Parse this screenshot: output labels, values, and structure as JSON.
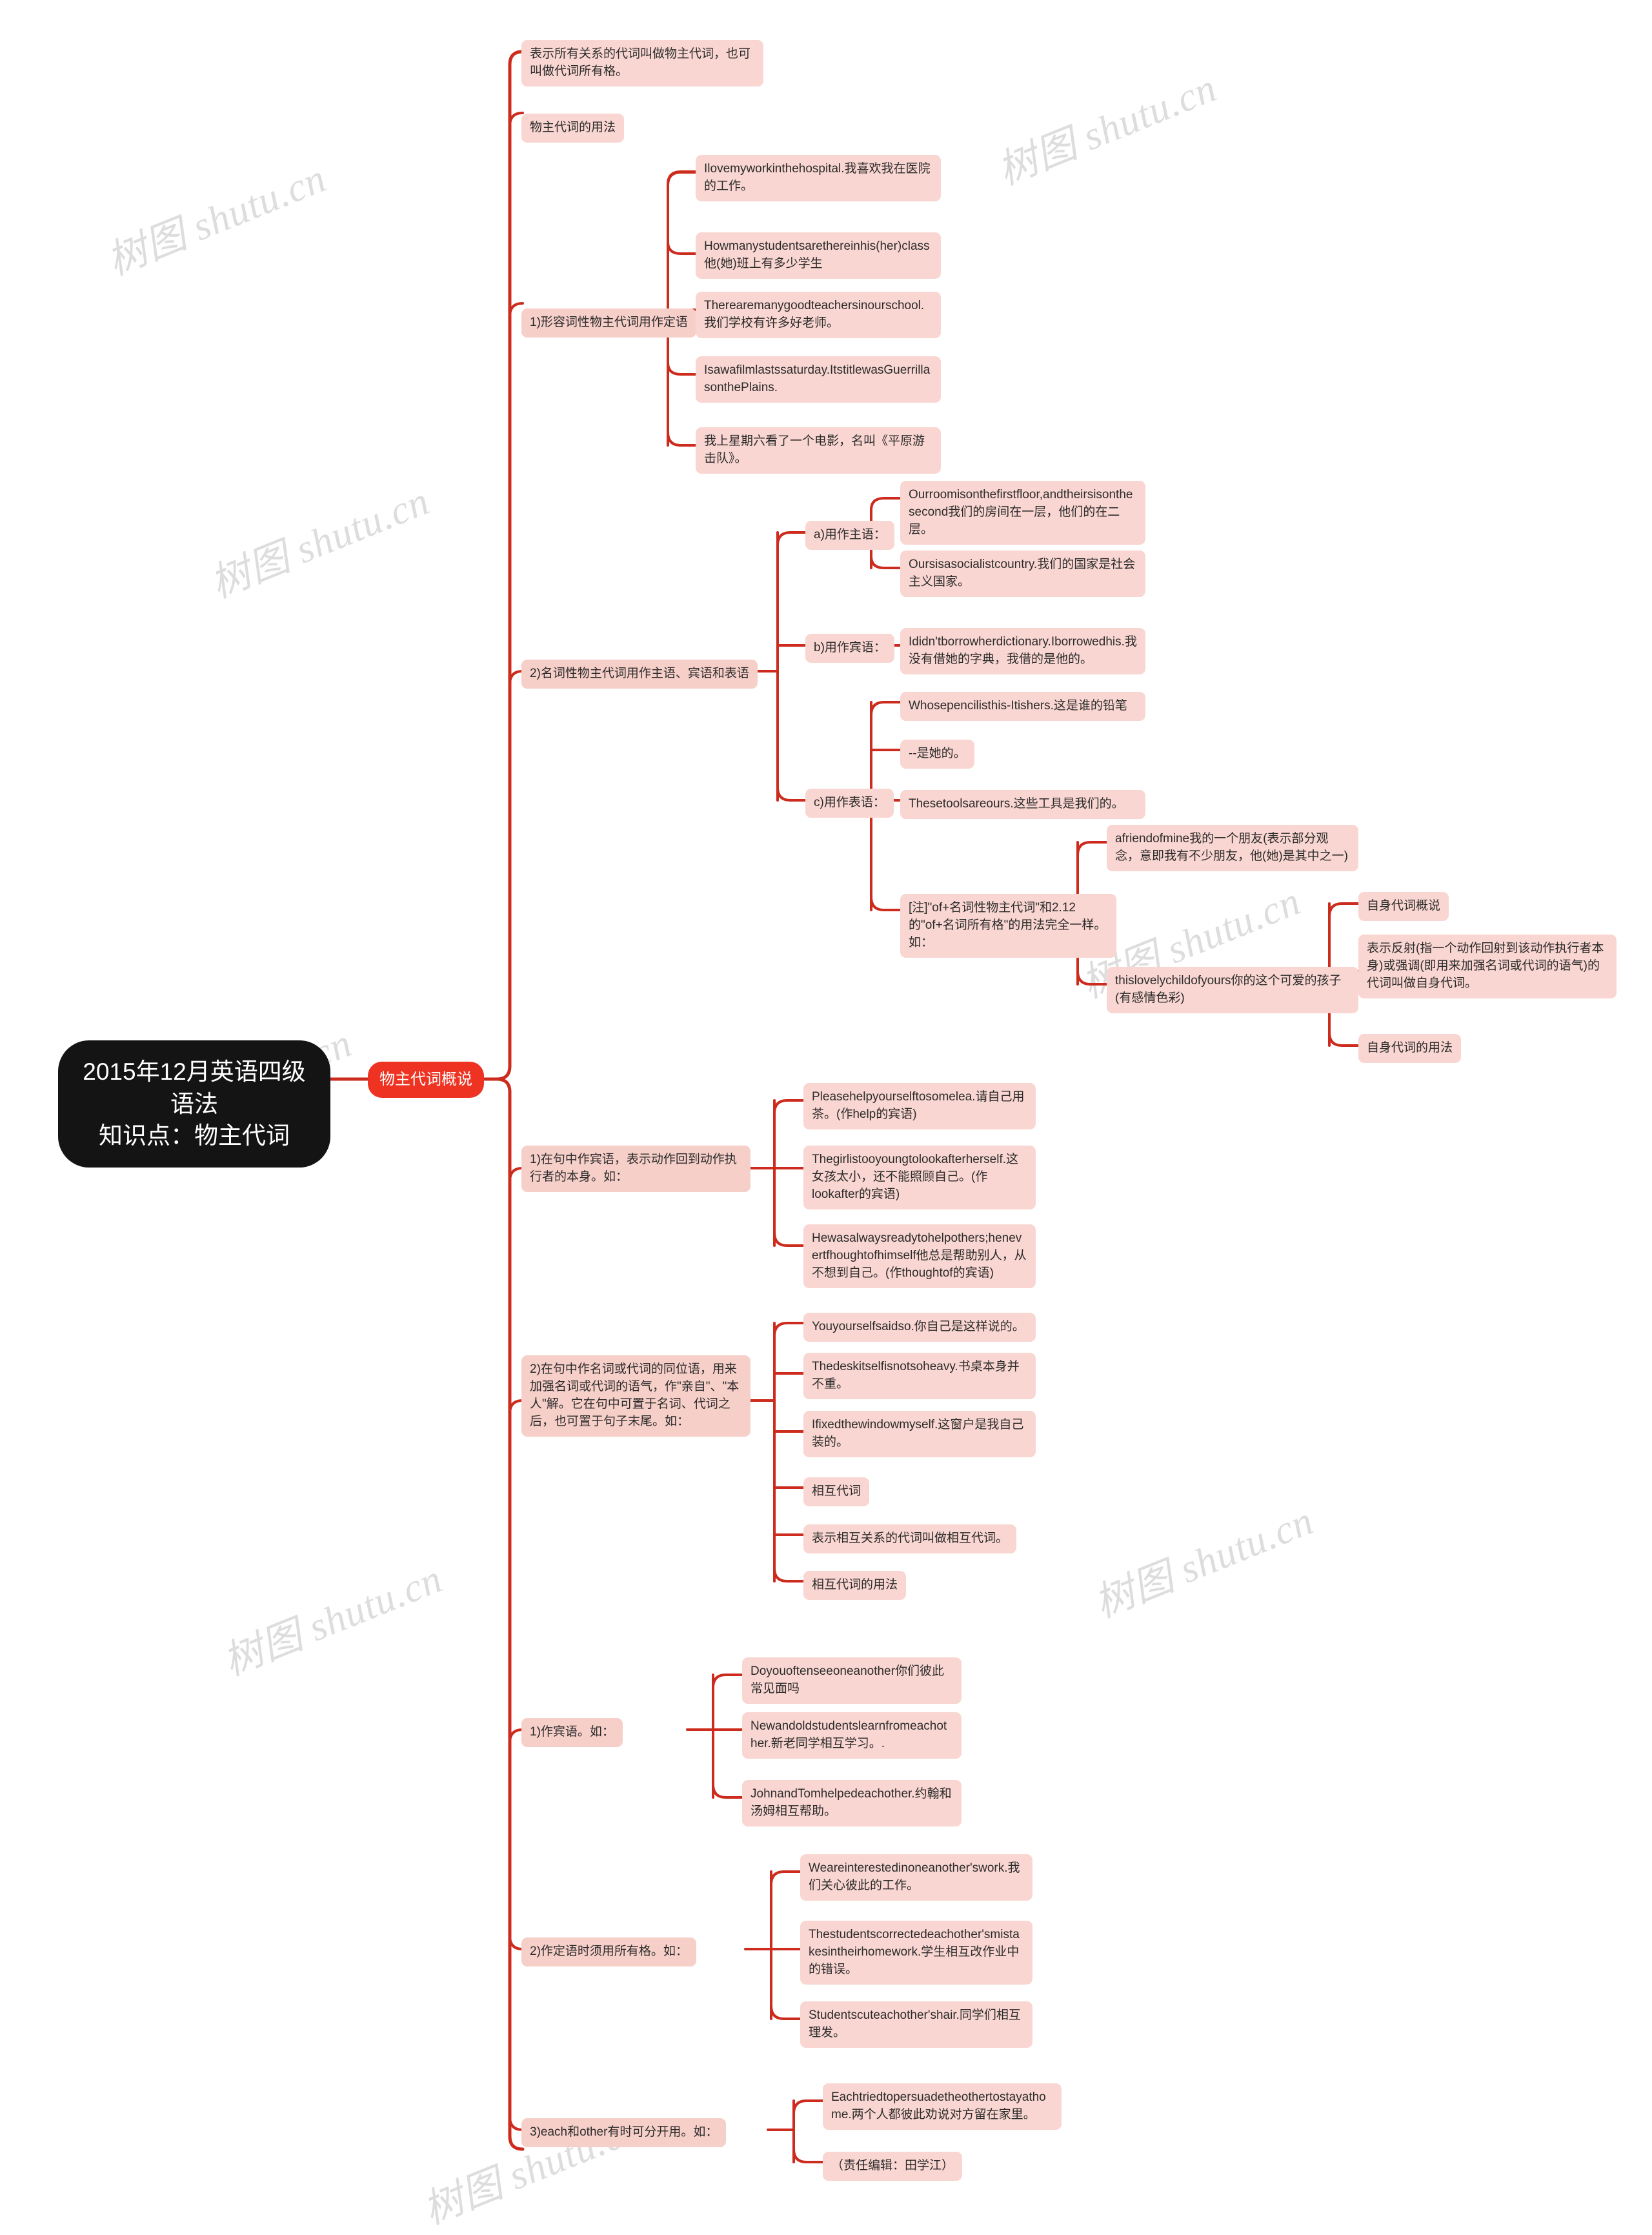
{
  "meta": {
    "accent_red": "#ee3322",
    "node_fill": "#f9d6d1",
    "root_fill": "#141414",
    "background": "#ffffff",
    "watermark_text": "树图 shutu.cn"
  },
  "root": {
    "label": "2015年12月英语四级语法\n知识点：物主代词"
  },
  "topic": {
    "label": "物主代词概说"
  },
  "nodes": {
    "n_intro": "表示所有关系的代词叫做物主代词，也可叫做代词所有格。",
    "n_usage": "物主代词的用法",
    "b1_label": "1)形容词性物主代词用作定语",
    "b1_e1": "Ilovemyworkinthehospital.我喜欢我在医院的工作。",
    "b1_e2": "Howmanystudentsarethereinhis(her)class他(她)班上有多少学生",
    "b1_e3": "Therearemanygoodteachersinourschool.我们学校有许多好老师。",
    "b1_e4": "Isawafilmlastssaturday.ItstitlewasGuerrillasonthePlains.",
    "b1_e5": "我上星期六看了一个电影，名叫《平原游击队》。",
    "b2_label": "2)名词性物主代词用作主语、宾语和表语",
    "b2_a_label": "a)用作主语：",
    "b2_a_e1": "Ourroomisonthefirstfloor,andtheirsisonthesecond我们的房间在一层，他们的在二层。",
    "b2_a_e2": "Oursisasocialistcountry.我们的国家是社会主义国家。",
    "b2_b_label": "b)用作宾语：",
    "b2_b_e1": "Ididn'tborrowherdictionary.Iborrowedhis.我没有借她的字典，我借的是他的。",
    "b2_c_label": "c)用作表语：",
    "b2_c_e1": "Whosepencilisthis-Itishers.这是谁的铅笔",
    "b2_c_e2": "--是她的。",
    "b2_c_e3": "Thesetoolsareours.这些工具是我们的。",
    "b2_note": "[注]\"of+名词性物主代词\"和2.12的\"of+名词所有格\"的用法完全一样。如：",
    "b2_note_e1": "afriendofmine我的一个朋友(表示部分观念，意即我有不少朋友，他(她)是其中之一)",
    "b2_note_e2": "thislovelychildofyours你的这个可爱的孩子(有感情色彩)",
    "self_intro": "自身代词概说",
    "self_def": "表示反射(指一个动作回射到该动作执行者本身)或强调(即用来加强名词或代词的语气)的代词叫做自身代词。",
    "self_usage": "自身代词的用法",
    "s1_label": "1)在句中作宾语，表示动作回到动作执行者的本身。如：",
    "s1_e1": "Pleasehelpyourselftosomelea.请自己用茶。(作help的宾语)",
    "s1_e2": "Thegirlistooyoungtolookafterherself.这女孩太小，还不能照顾自己。(作lookafter的宾语)",
    "s1_e3": "Hewasalwaysreadytohelpothers;henevertfhoughtofhimself他总是帮助别人，从不想到自己。(作thoughtof的宾语)",
    "s2_label": "2)在句中作名词或代词的同位语，用来加强名词或代词的语气，作\"亲自\"、\"本人\"解。它在句中可置于名词、代词之后，也可置于句子末尾。如：",
    "s2_e1": "Youyourselfsaidso.你自己是这样说的。",
    "s2_e2": "Thedeskitselfisnotsoheavy.书桌本身并不重。",
    "s2_e3": "Ifixedthewindowmyself.这窗户是我自己装的。",
    "s2_e4": "相互代词",
    "s2_e5": "表示相互关系的代词叫做相互代词。",
    "s2_e6": "相互代词的用法",
    "r1_label": "1)作宾语。如：",
    "r1_e1": "Doyouoftenseeoneanother你们彼此常见面吗",
    "r1_e2": "Newandoldstudentslearnfromeachother.新老同学相互学习。.",
    "r1_e3": "JohnandTomhelpedeachother.约翰和汤姆相互帮助。",
    "r2_label": "2)作定语时须用所有格。如：",
    "r2_e1": "Weareinterestedinoneanother'swork.我们关心彼此的工作。",
    "r2_e2": "Thestudentscorrectedeachother'smistakesintheirhomework.学生相互改作业中的错误。",
    "r2_e3": "Studentscuteachother'shair.同学们相互理发。",
    "r3_label": "3)each和other有时可分开用。如：",
    "r3_e1": "Eachtriedtopersuadetheothertostayathome.两个人都彼此劝说对方留在家里。",
    "r3_e2": "（责任编辑：田学江）"
  }
}
